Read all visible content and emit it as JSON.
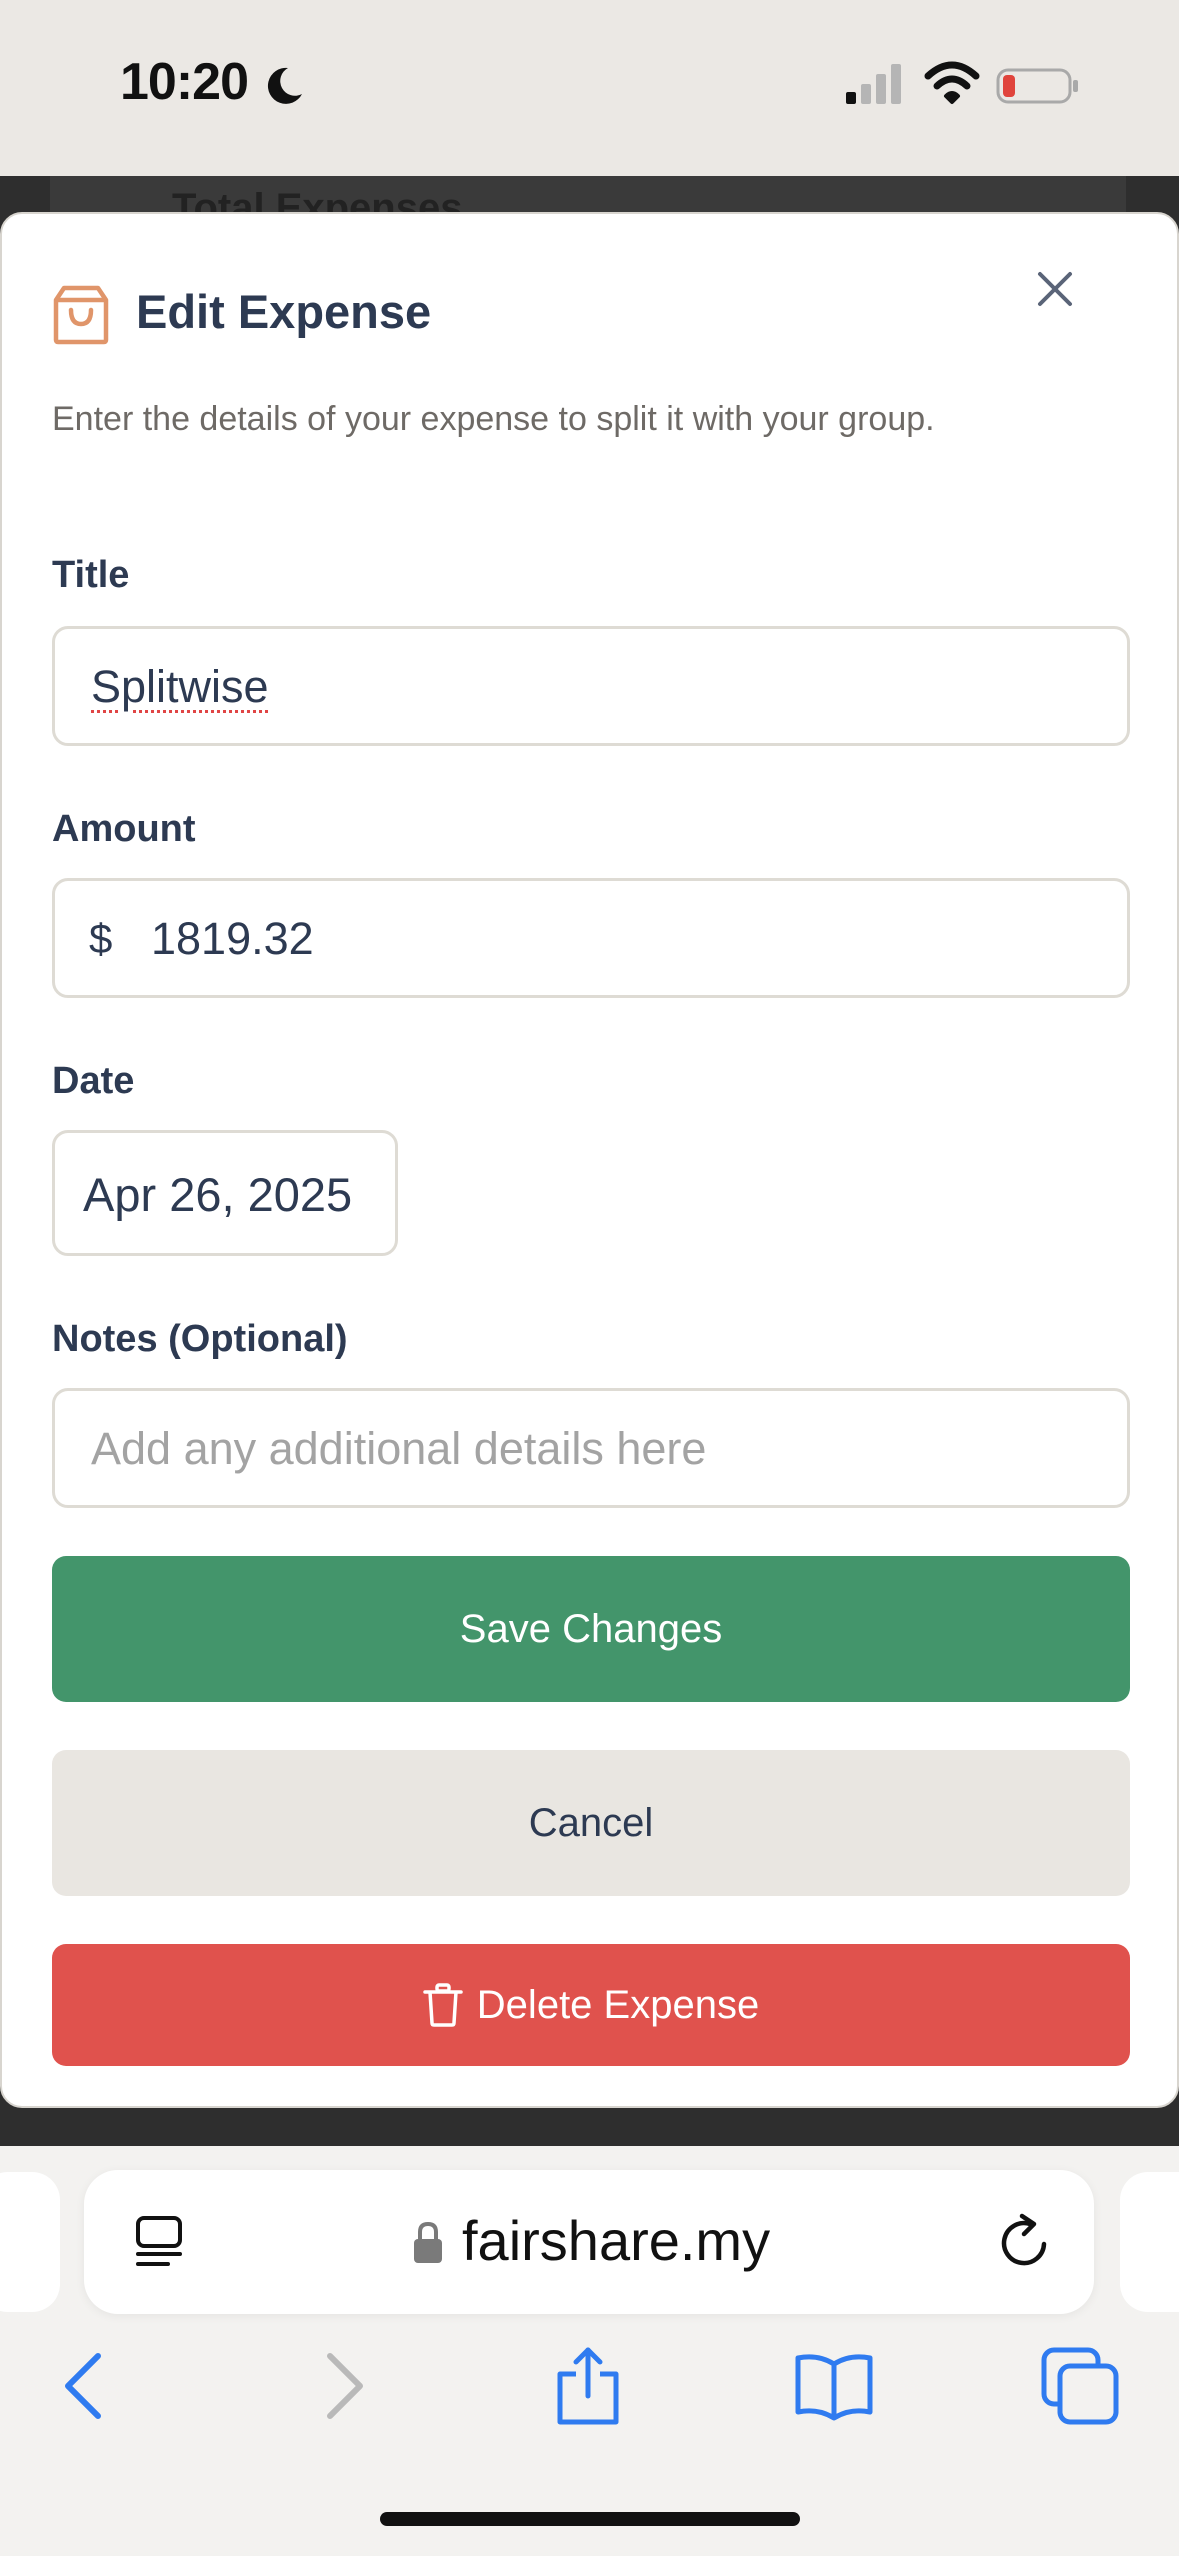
{
  "status_bar": {
    "time": "10:20",
    "icons": [
      "moon-icon",
      "signal-icon",
      "wifi-icon",
      "battery-icon"
    ],
    "battery_color": "#e0443c"
  },
  "background_page": {
    "heading": "Total Expenses"
  },
  "modal": {
    "title": "Edit Expense",
    "icon": "shopping-bag-icon",
    "description": "Enter the details of your expense to split it with your group.",
    "fields": {
      "title": {
        "label": "Title",
        "value": "Splitwise"
      },
      "amount": {
        "label": "Amount",
        "currency_symbol": "$",
        "value": "1819.32"
      },
      "date": {
        "label": "Date",
        "value": "Apr 26, 2025"
      },
      "notes": {
        "label": "Notes (Optional)",
        "value": "",
        "placeholder": "Add any additional details here"
      }
    },
    "buttons": {
      "save": "Save Changes",
      "cancel": "Cancel",
      "delete": "Delete Expense"
    },
    "colors": {
      "save": "#43956b",
      "cancel": "#e9e6e1",
      "delete": "#e0524d",
      "accent_icon": "#e0956a"
    }
  },
  "browser": {
    "url": "fairshare.my",
    "toolbar_icons": [
      "back-icon",
      "forward-icon",
      "share-icon",
      "bookmarks-icon",
      "tabs-icon"
    ],
    "accent": "#2f7bf0"
  }
}
